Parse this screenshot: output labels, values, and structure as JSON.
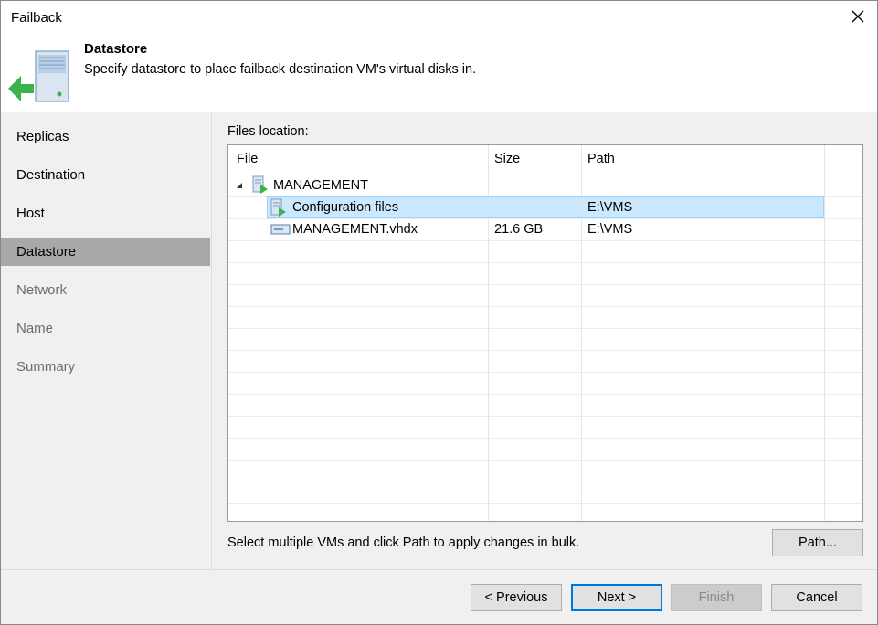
{
  "window": {
    "title": "Failback"
  },
  "header": {
    "title": "Datastore",
    "subtitle": "Specify datastore to place failback destination VM's virtual disks in."
  },
  "sidebar": {
    "items": [
      {
        "label": "Replicas",
        "state": "normal"
      },
      {
        "label": "Destination",
        "state": "normal"
      },
      {
        "label": "Host",
        "state": "normal"
      },
      {
        "label": "Datastore",
        "state": "active"
      },
      {
        "label": "Network",
        "state": "disabled"
      },
      {
        "label": "Name",
        "state": "disabled"
      },
      {
        "label": "Summary",
        "state": "disabled"
      }
    ]
  },
  "content": {
    "files_label": "Files location:",
    "columns": {
      "file": "File",
      "size": "Size",
      "path": "Path"
    },
    "rows": [
      {
        "file": "MANAGEMENT",
        "size": "",
        "path": ""
      },
      {
        "file": "Configuration files",
        "size": "",
        "path": "E:\\VMS"
      },
      {
        "file": "MANAGEMENT.vhdx",
        "size": "21.6 GB",
        "path": "E:\\VMS"
      }
    ],
    "bulk_note": "Select multiple VMs and click Path to apply changes in bulk.",
    "path_button": "Path..."
  },
  "footer": {
    "previous": "< Previous",
    "next": "Next >",
    "finish": "Finish",
    "cancel": "Cancel"
  },
  "colors": {
    "selection": "#cce8ff",
    "sidebar_active": "#a8a8a8",
    "accent_green": "#3cb34a",
    "primary_border": "#0078d7"
  }
}
